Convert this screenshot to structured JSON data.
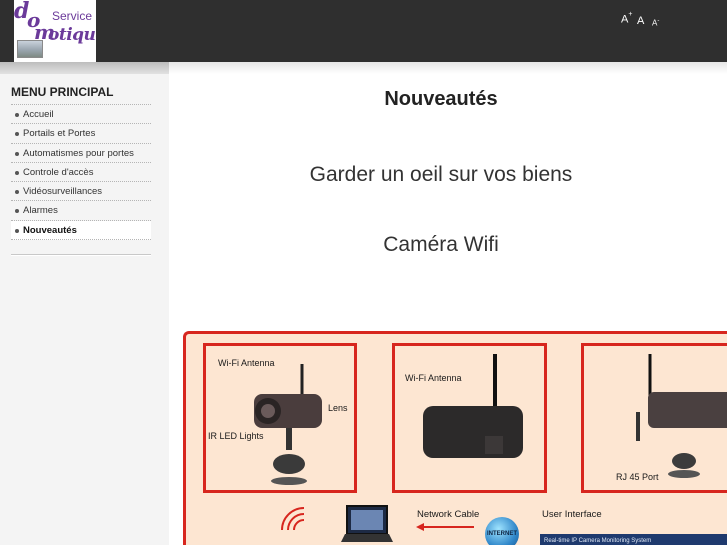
{
  "logo": {
    "line1": "Service",
    "letters": [
      "d",
      "o",
      "m",
      "otique"
    ]
  },
  "font_controls": {
    "increase": "A",
    "increase_sign": "+",
    "normal": "A",
    "decrease": "A",
    "decrease_sign": "-"
  },
  "sidebar": {
    "title": "MENU PRINCIPAL",
    "items": [
      {
        "label": "Accueil",
        "active": false
      },
      {
        "label": "Portails et Portes",
        "active": false
      },
      {
        "label": "Automatismes pour portes",
        "active": false
      },
      {
        "label": "Controle d'accès",
        "active": false
      },
      {
        "label": "Vidéosurveillances",
        "active": false
      },
      {
        "label": "Alarmes",
        "active": false
      },
      {
        "label": "Nouveautés",
        "active": true
      }
    ]
  },
  "main": {
    "title": "Nouveautés",
    "subtitle1": "Garder un oeil sur vos biens",
    "subtitle2": "Caméra Wifi"
  },
  "product_image": {
    "panel1": {
      "antenna": "Wi-Fi Antenna",
      "lens": "Lens",
      "ir": "IR LED Lights"
    },
    "panel2": {
      "antenna": "Wi-Fi Antenna"
    },
    "panel3": {
      "port": "RJ 45 Port"
    },
    "network_cable": "Network Cable",
    "user_interface": "User Interface",
    "internet": "INTERNET",
    "ui_bar_text": "Real-time IP Camera Monitoring System"
  },
  "colors": {
    "header_bg": "#2f2f2f",
    "logo_purple": "#6b3a9a",
    "sidebar_bg": "#f4f4f4",
    "image_red": "#d7261e",
    "image_bg": "#fde6d2"
  }
}
